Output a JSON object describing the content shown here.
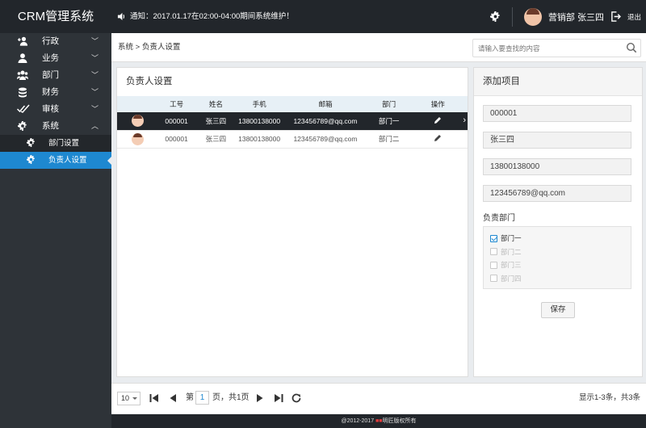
{
  "app": {
    "title": "CRM管理系统"
  },
  "notice": {
    "text": "通知：2017.01.17在02:00-04:00期间系统维护！"
  },
  "user": {
    "name": "营销部 张三四",
    "logout": "退出"
  },
  "sidebar": {
    "items": [
      {
        "label": "行政",
        "icon": "user-plus-icon"
      },
      {
        "label": "业务",
        "icon": "user-icon"
      },
      {
        "label": "部门",
        "icon": "users-icon"
      },
      {
        "label": "财务",
        "icon": "database-icon"
      },
      {
        "label": "审核",
        "icon": "check-double-icon"
      },
      {
        "label": "系统",
        "icon": "gear-icon"
      }
    ],
    "subitems": [
      {
        "label": "部门设置",
        "icon": "gear-icon"
      },
      {
        "label": "负责人设置",
        "icon": "gear-icon"
      }
    ]
  },
  "breadcrumb": {
    "text": "系统 > 负责人设置"
  },
  "search": {
    "placeholder": "请输入要查找的内容"
  },
  "list_panel": {
    "title": "负责人设置",
    "columns": [
      "",
      "工号",
      "姓名",
      "手机",
      "邮箱",
      "部门",
      "操作"
    ],
    "rows": [
      {
        "id": "000001",
        "name": "张三四",
        "phone": "13800138000",
        "email": "123456789@qq.com",
        "dept": "部门一"
      },
      {
        "id": "000001",
        "name": "张三四",
        "phone": "13800138000",
        "email": "123456789@qq.com",
        "dept": "部门二"
      }
    ]
  },
  "form_panel": {
    "title": "添加项目",
    "fields": {
      "id": "000001",
      "name": "张三四",
      "phone": "13800138000",
      "email": "123456789@qq.com"
    },
    "dept_label": "负责部门",
    "depts": [
      {
        "label": "部门一",
        "checked": true
      },
      {
        "label": "部门二",
        "checked": false
      },
      {
        "label": "部门三",
        "checked": false
      },
      {
        "label": "部门四",
        "checked": false
      }
    ],
    "save_label": "保存"
  },
  "pager": {
    "page_size": "10",
    "page_prefix": "第",
    "current_page": "1",
    "page_suffix": "页，共1页",
    "info": "显示1-3条，共3条"
  },
  "footer": {
    "prefix": "@2012-2017 ",
    "brand": "■■",
    "suffix": "明匠版权所有"
  },
  "colors": {
    "accent": "#1e88d0",
    "topbar": "#22262b",
    "sidebar": "#2e3338"
  }
}
